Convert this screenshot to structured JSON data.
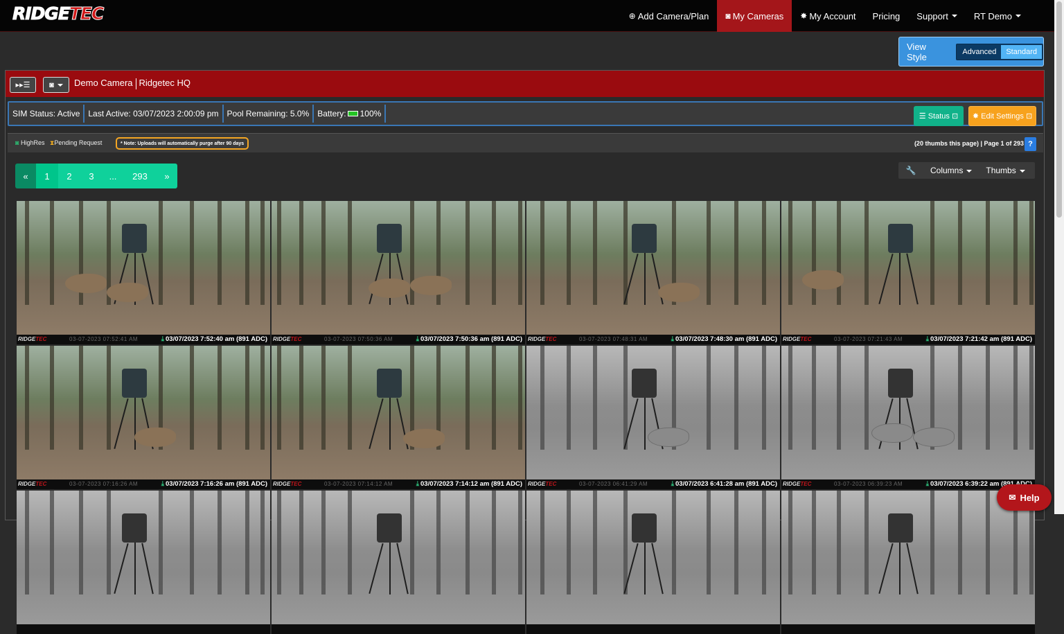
{
  "brand": {
    "logo_part1": "RIDGE",
    "logo_part2": "TEC"
  },
  "nav": {
    "add_camera": "Add Camera/Plan",
    "my_cameras": "My Cameras",
    "my_account": "My Account",
    "pricing": "Pricing",
    "support": "Support",
    "user": "RT Demo"
  },
  "view_style": {
    "label": "View Style",
    "advanced": "Advanced",
    "standard": "Standard",
    "selected": "Standard"
  },
  "camera": {
    "name": "Demo Camera",
    "location": "Ridgetec HQ"
  },
  "status": {
    "sim": "SIM Status: Active",
    "last_active": "Last Active: 03/07/2023 2:00:09 pm",
    "pool": "Pool Remaining: 5.0%",
    "battery_label": "Battery:",
    "battery_value": "100%",
    "status_btn": "Status",
    "edit_btn": "Edit Settings"
  },
  "legend": {
    "highres": "HighRes",
    "pending": "Pending Request",
    "note": "* Note: Uploads will automatically purge after 90 days",
    "thumb_count": "(20 thumbs this page) | Page 1 of 293",
    "help": "?"
  },
  "pagination": {
    "prev": "«",
    "pages": [
      "1",
      "2",
      "3",
      "...",
      "293"
    ],
    "next": "»",
    "current": "1"
  },
  "tools": {
    "columns": "Columns",
    "thumbs": "Thumbs"
  },
  "thumbs": [
    {
      "stamp": "03/07/2023 7:52:40 am (891 ADC)",
      "burned": "03-07-2023  07:52:41  AM",
      "mode": "color"
    },
    {
      "stamp": "03/07/2023 7:50:36 am (891 ADC)",
      "burned": "03-07-2023  07:50:36  AM",
      "mode": "color"
    },
    {
      "stamp": "03/07/2023 7:48:30 am (891 ADC)",
      "burned": "03-07-2023  07:48:31  AM",
      "mode": "color"
    },
    {
      "stamp": "03/07/2023 7:21:42 am (891 ADC)",
      "burned": "03-07-2023  07:21:43  AM",
      "mode": "color"
    },
    {
      "stamp": "03/07/2023 7:16:26 am (891 ADC)",
      "burned": "03-07-2023  07:16:26  AM",
      "mode": "color"
    },
    {
      "stamp": "03/07/2023 7:14:12 am (891 ADC)",
      "burned": "03-07-2023  07:14:12  AM",
      "mode": "color"
    },
    {
      "stamp": "03/07/2023 6:41:28 am (891 ADC)",
      "burned": "03-07-2023  06:41:29  AM",
      "mode": "gray"
    },
    {
      "stamp": "03/07/2023 6:39:22 am (891 ADC)",
      "burned": "03-07-2023  06:39:23  AM",
      "mode": "gray"
    },
    {
      "stamp": "",
      "burned": "",
      "mode": "gray"
    },
    {
      "stamp": "",
      "burned": "",
      "mode": "gray"
    },
    {
      "stamp": "",
      "burned": "",
      "mode": "gray"
    },
    {
      "stamp": "",
      "burned": "",
      "mode": "gray"
    }
  ],
  "help_button": "Help",
  "icons": [
    "plus-circle-icon",
    "camera-icon",
    "gear-icon",
    "fast-forward-list-icon",
    "camera-dropdown-icon",
    "list-icon",
    "wrench-icon",
    "download-icon",
    "envelope-icon",
    "hourglass-icon"
  ],
  "colors": {
    "accent_red": "#9a0b0f",
    "nav_active": "#a4161a",
    "teal": "#0fd19b",
    "status_green": "#11b28a",
    "edit_orange": "#f7a21d",
    "view_blue": "#3a93de"
  }
}
